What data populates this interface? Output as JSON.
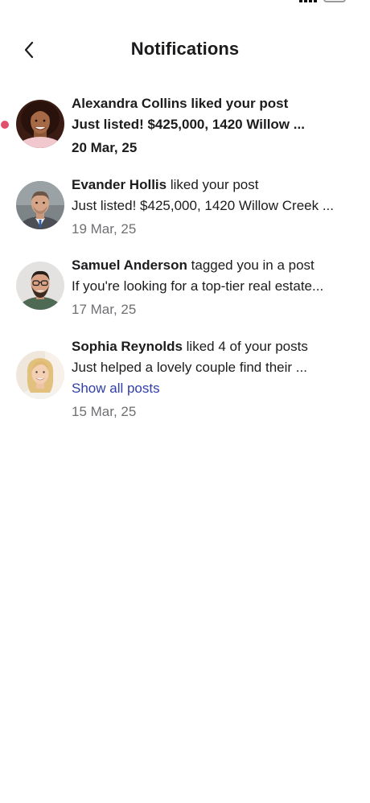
{
  "header": {
    "title": "Notifications",
    "back_icon": "chevron-left-icon"
  },
  "colors": {
    "unread_dot": "#e0506a",
    "link": "#2f3ea8",
    "date": "#6f6f74",
    "text": "#1c1c1e"
  },
  "notifications": [
    {
      "name": "Alexandra Collins",
      "action": "liked your post",
      "preview": "Just listed! $425,000, 1420 Willow ...",
      "date": "20 Mar, 25",
      "unread": true
    },
    {
      "name": "Evander Hollis",
      "action": "liked your post",
      "preview": "Just listed! $425,000, 1420 Willow Creek ...",
      "date": "19 Mar, 25",
      "unread": false
    },
    {
      "name": "Samuel Anderson",
      "action": "tagged you in a post",
      "preview": "If you're looking for a top-tier real estate...",
      "date": "17 Mar, 25",
      "unread": false
    },
    {
      "name": "Sophia Reynolds",
      "action": "liked 4 of your posts",
      "preview": "Just helped a lovely couple find their ...",
      "link": "Show all posts",
      "date": "15 Mar, 25",
      "unread": false
    }
  ]
}
